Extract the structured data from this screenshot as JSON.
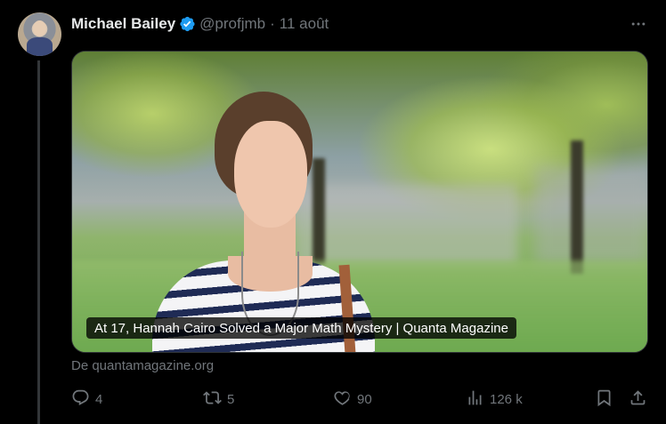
{
  "tweet": {
    "author_name": "Michael Bailey",
    "handle": "@profjmb",
    "separator": "·",
    "date": "11 août"
  },
  "media": {
    "caption": "At 17, Hannah Cairo Solved a Major Math Mystery | Quanta Magazine",
    "source": "De quantamagazine.org"
  },
  "actions": {
    "replies": "4",
    "reposts": "5",
    "likes": "90",
    "views": "126 k"
  },
  "colors": {
    "background": "#000000",
    "text": "#e7e9ea",
    "muted": "#71767b",
    "verified": "#1d9bf0"
  },
  "icons": [
    "verified-badge-icon",
    "more-icon",
    "reply-icon",
    "repost-icon",
    "like-icon",
    "views-icon",
    "bookmark-icon",
    "share-icon"
  ]
}
